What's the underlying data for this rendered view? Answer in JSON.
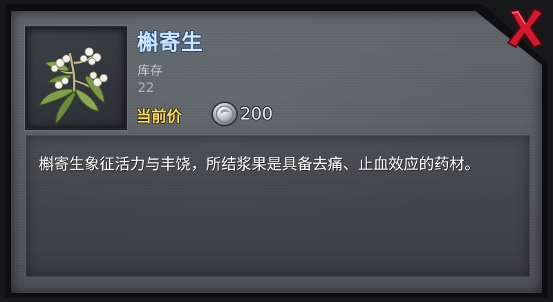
{
  "item": {
    "name": "槲寄生",
    "stock_label": "库存",
    "stock_value": "22",
    "price_label": "当前价",
    "price_value": "200",
    "currency_icon": "silver-coin-icon",
    "image_icon": "mistletoe-icon",
    "description": "槲寄生象征活力与丰饶，所结浆果是具备去痛、止血效应的药材。"
  },
  "controls": {
    "close_icon": "close-x-icon"
  },
  "colors": {
    "panel": "#5b6167",
    "name_text": "#cfe6ff",
    "price_label": "#f5d768",
    "close_red": "#c8102e"
  }
}
